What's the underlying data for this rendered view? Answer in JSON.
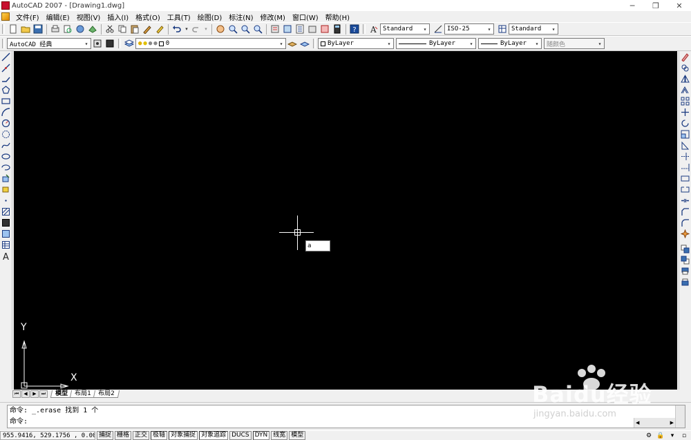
{
  "window": {
    "title": "AutoCAD 2007 - [Drawing1.dwg]",
    "minimize": "─",
    "restore": "❐",
    "close": "✕"
  },
  "menu": {
    "items": [
      "文件(F)",
      "编辑(E)",
      "视图(V)",
      "插入(I)",
      "格式(O)",
      "工具(T)",
      "绘图(D)",
      "标注(N)",
      "修改(M)",
      "窗口(W)",
      "帮助(H)"
    ]
  },
  "toolbar1": {
    "text_style": "Standard",
    "dim_style": "ISO-25",
    "table_style": "Standard"
  },
  "toolbar2": {
    "workspace": "AutoCAD 经典",
    "layer": "0",
    "color": "ByLayer",
    "linetype": "ByLayer",
    "lineweight": "ByLayer",
    "plot_style": "随颜色"
  },
  "canvas": {
    "dyn_input_value": "a",
    "ucs_x_label": "X",
    "ucs_y_label": "Y"
  },
  "tabs": {
    "items": [
      "模型",
      "布局1",
      "布局2"
    ],
    "active": "模型"
  },
  "command": {
    "history_line": "命令: _.erase 找到 1 个",
    "prompt_line": "命令:"
  },
  "status": {
    "coordinates": "955.9416,  529.1756 , 0.0000",
    "buttons": [
      "捕捉",
      "栅格",
      "正交",
      "极轴",
      "对象捕捉",
      "对象追踪",
      "DUCS",
      "DYN",
      "线宽",
      "模型"
    ]
  },
  "watermark": {
    "brand": "Baidu经验",
    "url": "jingyan.baidu.com"
  },
  "colors": {
    "canvas_bg": "#000000",
    "chrome_bg": "#f0f0f0"
  }
}
